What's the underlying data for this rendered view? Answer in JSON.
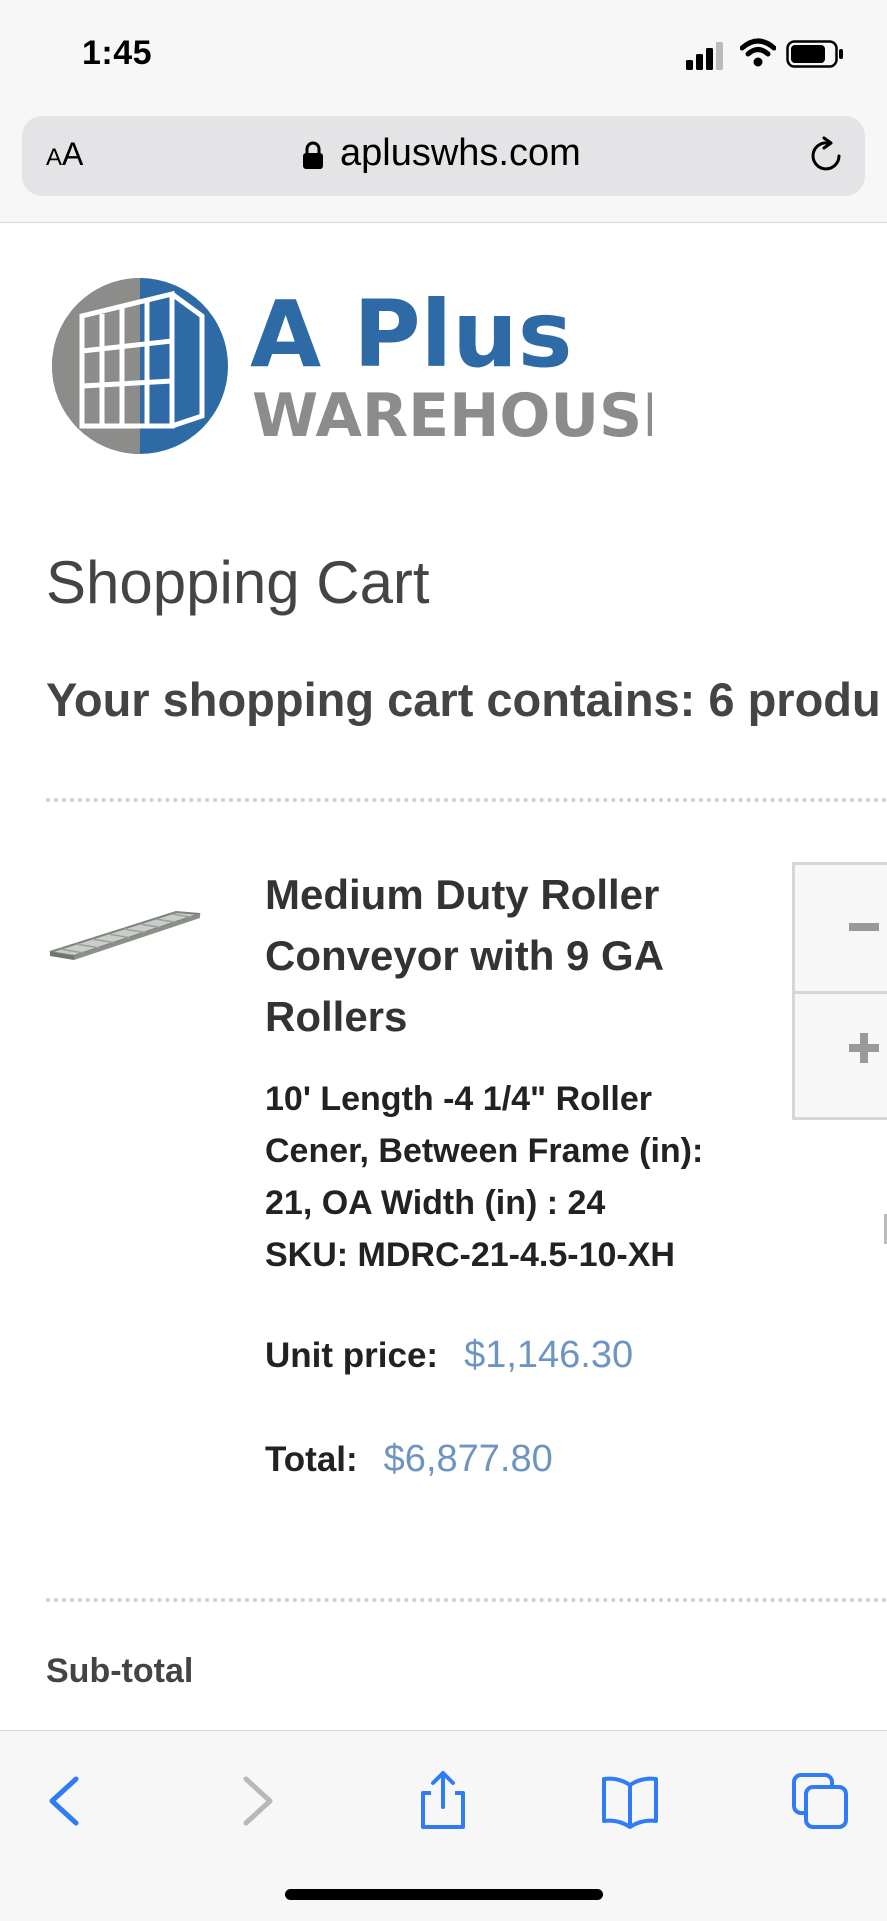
{
  "status_bar": {
    "time": "1:45"
  },
  "browser": {
    "text_size_label": "AA",
    "url": "apluswhs.com"
  },
  "logo": {
    "line1": "A Plus",
    "line2": "WAREHOUSE",
    "colors": {
      "blue": "#2d6aa6",
      "gray": "#8c8c8a"
    }
  },
  "page": {
    "title": "Shopping Cart",
    "cart_summary": "Your shopping cart contains: 6 produ"
  },
  "product": {
    "name": "Medium Duty Roller Conveyor with 9 GA Rollers",
    "description": "10' Length -4 1/4\" Roller Cener, Between Frame (in): 21, OA Width (in) : 24",
    "sku": "SKU: MDRC-21-4.5-10-XH",
    "unit_price_label": "Unit price:",
    "unit_price": "$1,146.30",
    "total_label": "Total:",
    "total": "$6,877.80",
    "image_icon": "roller-conveyor-image"
  },
  "subtotal_label": "Sub-total",
  "toolbar": {
    "icons": [
      "back-icon",
      "forward-icon",
      "share-icon",
      "bookmarks-icon",
      "tabs-icon"
    ]
  },
  "colors": {
    "link_price": "#6e95c2",
    "ios_blue": "#2f7cf6"
  }
}
